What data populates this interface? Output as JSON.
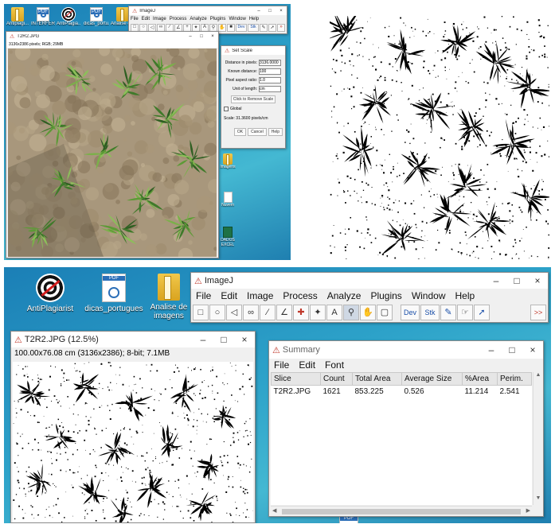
{
  "top_left": {
    "desktop_icons": [
      {
        "label": "Antiplagi..."
      },
      {
        "label": "INTERFER..."
      },
      {
        "label": "AntiPlagia..."
      },
      {
        "label": "dicas_portu..."
      },
      {
        "label": "Analise de..."
      }
    ],
    "right_icons": [
      {
        "label": "Imagens"
      },
      {
        "label": "Nuvem"
      },
      {
        "label": "DADOS EXCEL"
      }
    ],
    "imagej": {
      "title": "ImageJ",
      "menu": [
        "File",
        "Edit",
        "Image",
        "Process",
        "Analyze",
        "Plugins",
        "Window",
        "Help"
      ],
      "dev_label": "Dev",
      "stk_label": "Stk"
    },
    "image_window": {
      "title": "T2R2.JPG",
      "info": "3136x2386 pixels; RGB; 29MB"
    },
    "set_scale": {
      "title": "Set Scale",
      "fields": [
        {
          "label": "Distance in pixels:",
          "value": "3136.0000"
        },
        {
          "label": "Known distance:",
          "value": "100"
        },
        {
          "label": "Pixel aspect ratio:",
          "value": "1.0"
        },
        {
          "label": "Unit of length:",
          "value": "cm"
        }
      ],
      "remove_button": "Click to Remove Scale",
      "global_label": "Global",
      "scale_text": "Scale: 31.3600 pixels/cm",
      "buttons": [
        "OK",
        "Cancel",
        "Help"
      ]
    }
  },
  "bottom": {
    "desktop_icons": [
      {
        "label": "AntiPlagiarist"
      },
      {
        "label": "dicas_portugues"
      },
      {
        "label": "Analise de imagens"
      }
    ],
    "imagej": {
      "title": "ImageJ",
      "menu": [
        "File",
        "Edit",
        "Image",
        "Process",
        "Analyze",
        "Plugins",
        "Window",
        "Help"
      ],
      "dev_label": "Dev",
      "stk_label": "Stk",
      "more_label": ">>"
    },
    "image_window": {
      "title": "T2R2.JPG (12.5%)",
      "info": "100.00x76.08 cm (3136x2386); 8-bit; 7.1MB"
    },
    "summary": {
      "title": "Summary",
      "menu": [
        "File",
        "Edit",
        "Font"
      ],
      "columns": [
        "Slice",
        "Count",
        "Total Area",
        "Average Size",
        "%Area",
        "Perim."
      ],
      "rows": [
        [
          "T2R2.JPG",
          "1621",
          "853.225",
          "0.526",
          "11.214",
          "2.541"
        ]
      ]
    },
    "bottom_icon_label": "PDF"
  },
  "colors": {
    "desktop": "#2a9bc8",
    "window_bg": "#f0f0f0",
    "title_bg": "#ffffff",
    "mark_red": "#c0392b",
    "header_bg": "#e6e6e6"
  }
}
